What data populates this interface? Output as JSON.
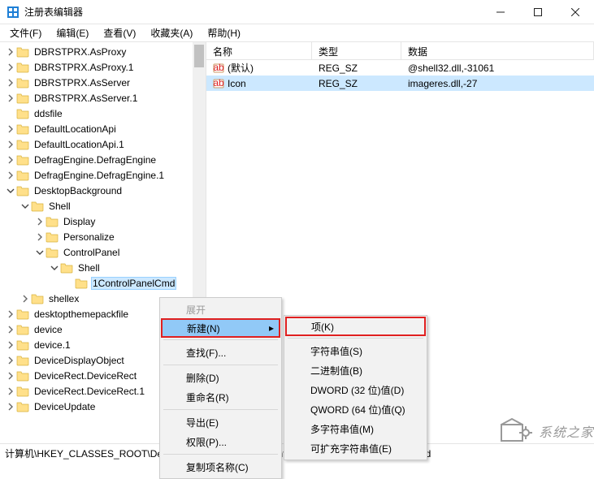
{
  "window": {
    "title": "注册表编辑器"
  },
  "menubar": [
    "文件(F)",
    "编辑(E)",
    "查看(V)",
    "收藏夹(A)",
    "帮助(H)"
  ],
  "tree": [
    {
      "indent": 0,
      "chev": ">",
      "label": "DBRSTPRX.AsProxy"
    },
    {
      "indent": 0,
      "chev": ">",
      "label": "DBRSTPRX.AsProxy.1"
    },
    {
      "indent": 0,
      "chev": ">",
      "label": "DBRSTPRX.AsServer"
    },
    {
      "indent": 0,
      "chev": ">",
      "label": "DBRSTPRX.AsServer.1"
    },
    {
      "indent": 0,
      "chev": "",
      "label": "ddsfile"
    },
    {
      "indent": 0,
      "chev": ">",
      "label": "DefaultLocationApi"
    },
    {
      "indent": 0,
      "chev": ">",
      "label": "DefaultLocationApi.1"
    },
    {
      "indent": 0,
      "chev": ">",
      "label": "DefragEngine.DefragEngine"
    },
    {
      "indent": 0,
      "chev": ">",
      "label": "DefragEngine.DefragEngine.1"
    },
    {
      "indent": 0,
      "chev": "v",
      "label": "DesktopBackground"
    },
    {
      "indent": 1,
      "chev": "v",
      "label": "Shell"
    },
    {
      "indent": 2,
      "chev": ">",
      "label": "Display"
    },
    {
      "indent": 2,
      "chev": ">",
      "label": "Personalize"
    },
    {
      "indent": 2,
      "chev": "v",
      "label": "ControlPanel"
    },
    {
      "indent": 3,
      "chev": "v",
      "label": "Shell"
    },
    {
      "indent": 4,
      "chev": "",
      "label": "1ControlPanelCmd",
      "selected": true
    },
    {
      "indent": 1,
      "chev": ">",
      "label": "shellex"
    },
    {
      "indent": 0,
      "chev": ">",
      "label": "desktopthemepackfile"
    },
    {
      "indent": 0,
      "chev": ">",
      "label": "device"
    },
    {
      "indent": 0,
      "chev": ">",
      "label": "device.1"
    },
    {
      "indent": 0,
      "chev": ">",
      "label": "DeviceDisplayObject"
    },
    {
      "indent": 0,
      "chev": ">",
      "label": "DeviceRect.DeviceRect"
    },
    {
      "indent": 0,
      "chev": ">",
      "label": "DeviceRect.DeviceRect.1"
    },
    {
      "indent": 0,
      "chev": ">",
      "label": "DeviceUpdate"
    }
  ],
  "list": {
    "headers": {
      "name": "名称",
      "type": "类型",
      "data": "数据"
    },
    "rows": [
      {
        "name": "(默认)",
        "type": "REG_SZ",
        "data": "@shell32.dll,-31061",
        "selected": false
      },
      {
        "name": "Icon",
        "type": "REG_SZ",
        "data": "imageres.dll,-27",
        "selected": true
      }
    ]
  },
  "ctx1": {
    "items": [
      {
        "label": "展开",
        "disabled": true
      },
      {
        "label": "新建(N)",
        "hl": true,
        "sub": true,
        "red": true
      },
      {
        "sep": true
      },
      {
        "label": "查找(F)..."
      },
      {
        "sep": true
      },
      {
        "label": "删除(D)"
      },
      {
        "label": "重命名(R)"
      },
      {
        "sep": true
      },
      {
        "label": "导出(E)"
      },
      {
        "label": "权限(P)..."
      },
      {
        "sep": true
      },
      {
        "label": "复制项名称(C)"
      }
    ]
  },
  "ctx2": {
    "items": [
      {
        "label": "项(K)",
        "red": true
      },
      {
        "sep": true
      },
      {
        "label": "字符串值(S)"
      },
      {
        "label": "二进制值(B)"
      },
      {
        "label": "DWORD (32 位)值(D)"
      },
      {
        "label": "QWORD (64 位)值(Q)"
      },
      {
        "label": "多字符串值(M)"
      },
      {
        "label": "可扩充字符串值(E)"
      }
    ]
  },
  "status": "计算机\\HKEY_CLASSES_ROOT\\DesktopBackground\\Shell\\ControlPanel\\Shell\\1ControlPanelCmd",
  "watermark": "系统之家"
}
